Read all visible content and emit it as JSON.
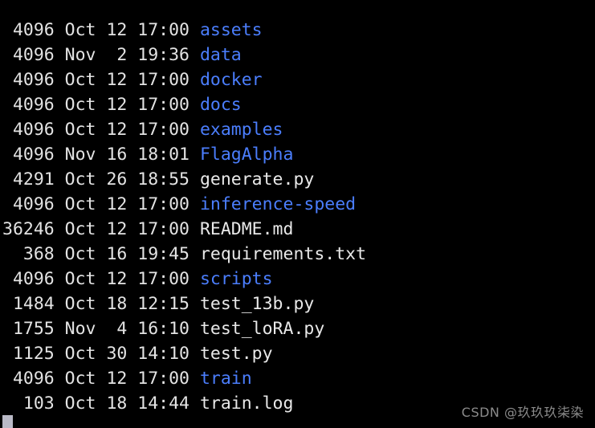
{
  "terminal": {
    "background_color": "#000000",
    "text_color": "#e3e3e3",
    "directory_color": "#4b7efd",
    "file_color": "#e8e8e8",
    "cursor_color": "#b9b9c6"
  },
  "listing": {
    "entries": [
      {
        "size": "4096",
        "month": "Oct",
        "day": "12",
        "time": "17:00",
        "name": "assets",
        "type": "dir"
      },
      {
        "size": "4096",
        "month": "Nov",
        "day": "2",
        "time": "19:36",
        "name": "data",
        "type": "dir"
      },
      {
        "size": "4096",
        "month": "Oct",
        "day": "12",
        "time": "17:00",
        "name": "docker",
        "type": "dir"
      },
      {
        "size": "4096",
        "month": "Oct",
        "day": "12",
        "time": "17:00",
        "name": "docs",
        "type": "dir"
      },
      {
        "size": "4096",
        "month": "Oct",
        "day": "12",
        "time": "17:00",
        "name": "examples",
        "type": "dir"
      },
      {
        "size": "4096",
        "month": "Nov",
        "day": "16",
        "time": "18:01",
        "name": "FlagAlpha",
        "type": "dir"
      },
      {
        "size": "4291",
        "month": "Oct",
        "day": "26",
        "time": "18:55",
        "name": "generate.py",
        "type": "file"
      },
      {
        "size": "4096",
        "month": "Oct",
        "day": "12",
        "time": "17:00",
        "name": "inference-speed",
        "type": "dir"
      },
      {
        "size": "36246",
        "month": "Oct",
        "day": "12",
        "time": "17:00",
        "name": "README.md",
        "type": "file"
      },
      {
        "size": "368",
        "month": "Oct",
        "day": "16",
        "time": "19:45",
        "name": "requirements.txt",
        "type": "file"
      },
      {
        "size": "4096",
        "month": "Oct",
        "day": "12",
        "time": "17:00",
        "name": "scripts",
        "type": "dir"
      },
      {
        "size": "1484",
        "month": "Oct",
        "day": "18",
        "time": "12:15",
        "name": "test_13b.py",
        "type": "file"
      },
      {
        "size": "1755",
        "month": "Nov",
        "day": "4",
        "time": "16:10",
        "name": "test_loRA.py",
        "type": "file"
      },
      {
        "size": "1125",
        "month": "Oct",
        "day": "30",
        "time": "14:10",
        "name": "test.py",
        "type": "file"
      },
      {
        "size": "4096",
        "month": "Oct",
        "day": "12",
        "time": "17:00",
        "name": "train",
        "type": "dir"
      },
      {
        "size": "103",
        "month": "Oct",
        "day": "18",
        "time": "14:44",
        "name": "train.log",
        "type": "file"
      }
    ]
  },
  "cursor": {
    "label": "block-cursor"
  },
  "watermark": {
    "text": "CSDN @玖玖玖柒染"
  }
}
